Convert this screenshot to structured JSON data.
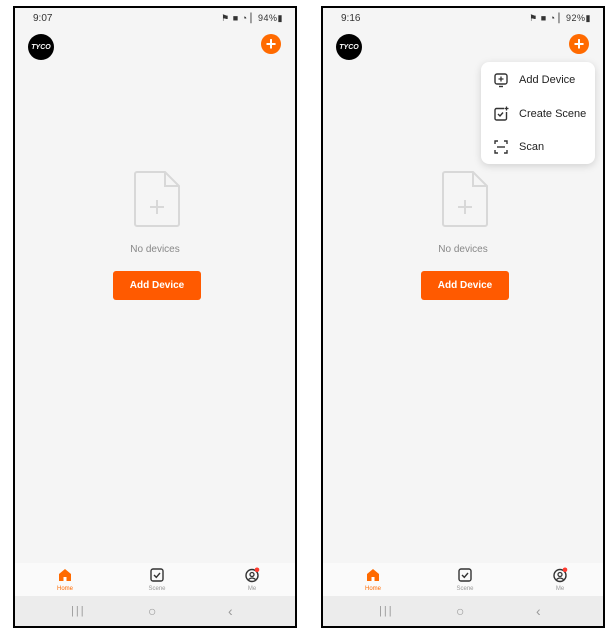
{
  "left": {
    "status_time": "9:07",
    "status_icons": "⚑ ■ ◔ ▏94%▮",
    "logo_text": "TYCO",
    "empty_text": "No devices",
    "add_button": "Add Device",
    "tabs": [
      {
        "label": "Home"
      },
      {
        "label": "Scene"
      },
      {
        "label": "Me"
      }
    ]
  },
  "right": {
    "status_time": "9:16",
    "status_icons": "⚑ ■ ◔ ▏92%▮",
    "logo_text": "TYCO",
    "empty_text": "No devices",
    "add_button": "Add Device",
    "tabs": [
      {
        "label": "Home"
      },
      {
        "label": "Scene"
      },
      {
        "label": "Me"
      }
    ],
    "menu": [
      {
        "label": "Add Device",
        "icon": "add-device-icon"
      },
      {
        "label": "Create Scene",
        "icon": "create-scene-icon"
      },
      {
        "label": "Scan",
        "icon": "scan-icon"
      }
    ]
  },
  "colors": {
    "accent": "#ff6a00",
    "button": "#ff5a00",
    "background": "#f5f5f5"
  }
}
